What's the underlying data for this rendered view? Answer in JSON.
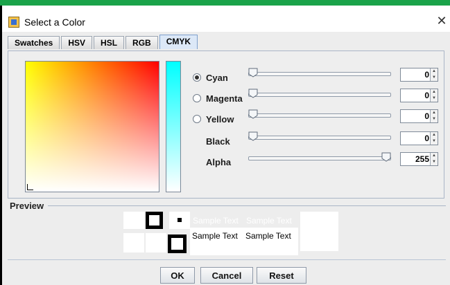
{
  "window": {
    "title": "Select a Color",
    "close_glyph": "✕",
    "icon": "java-app-icon"
  },
  "tabs": [
    {
      "label": "Swatches",
      "active": false
    },
    {
      "label": "HSV",
      "active": false
    },
    {
      "label": "HSL",
      "active": false
    },
    {
      "label": "RGB",
      "active": false
    },
    {
      "label": "CMYK",
      "active": true
    }
  ],
  "cmyk": {
    "rows": [
      {
        "label": "Cyan",
        "value": "0",
        "selected": true,
        "has_radio": true
      },
      {
        "label": "Magenta",
        "value": "0",
        "selected": false,
        "has_radio": true
      },
      {
        "label": "Yellow",
        "value": "0",
        "selected": false,
        "has_radio": true
      },
      {
        "label": "Black",
        "value": "0",
        "selected": false,
        "has_radio": false
      },
      {
        "label": "Alpha",
        "value": "255",
        "selected": false,
        "has_radio": false
      }
    ],
    "spin_up": "▲",
    "spin_down": "▼"
  },
  "preview": {
    "label": "Preview",
    "sample_text_1": "Sample Text",
    "sample_text_2": "Sample Text",
    "sample_text_3": "Sample Text",
    "sample_text_4": "Sample Text"
  },
  "buttons": {
    "ok": "OK",
    "cancel": "Cancel",
    "reset": "Reset"
  },
  "colors": {
    "selected_color": "#ffffff",
    "accent": "#7ea0cc",
    "title_bar_strip": "#1aa34a"
  }
}
